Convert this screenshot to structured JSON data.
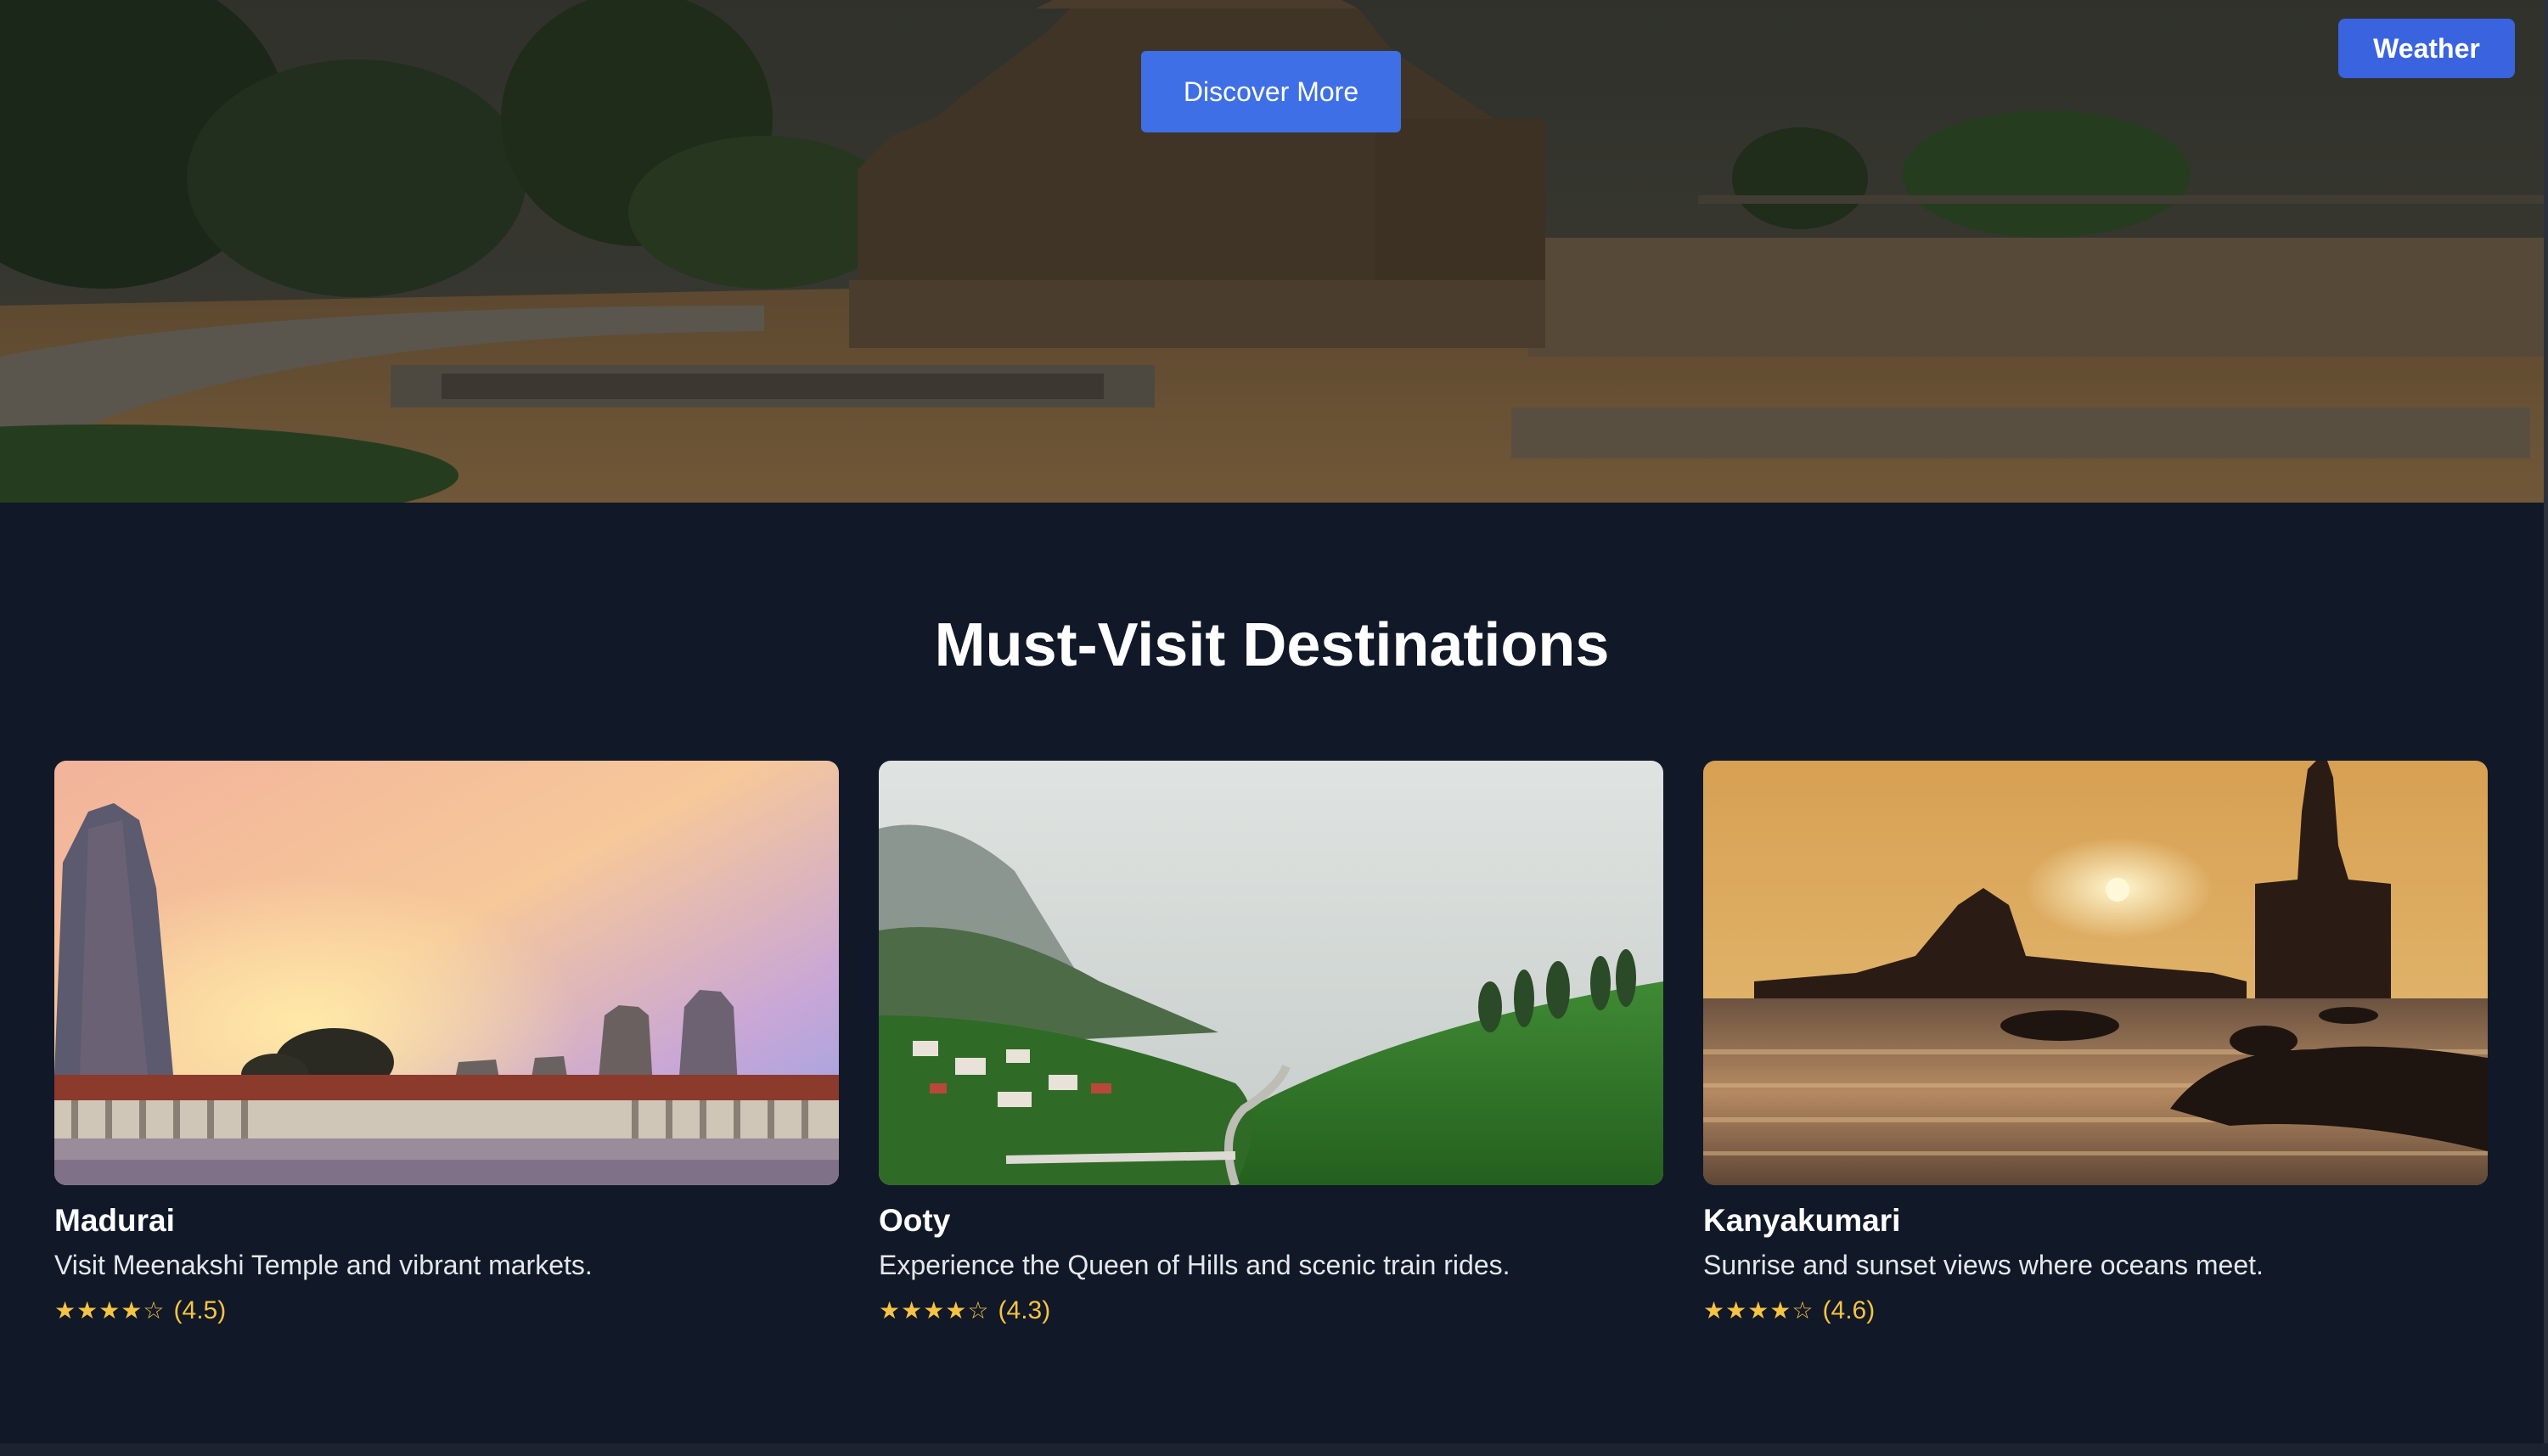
{
  "hero": {
    "discover_label": "Discover More",
    "weather_label": "Weather"
  },
  "section": {
    "title": "Must-Visit Destinations"
  },
  "cards": [
    {
      "title": "Madurai",
      "description": "Visit Meenakshi Temple and vibrant markets.",
      "stars": "★★★★☆",
      "rating": 4.5,
      "rating_text": "(4.5)"
    },
    {
      "title": "Ooty",
      "description": "Experience the Queen of Hills and scenic train rides.",
      "stars": "★★★★☆",
      "rating": 4.3,
      "rating_text": "(4.3)"
    },
    {
      "title": "Kanyakumari",
      "description": "Sunrise and sunset views where oceans meet.",
      "stars": "★★★★☆",
      "rating": 4.6,
      "rating_text": "(4.6)"
    }
  ],
  "colors": {
    "page_background": "#111827",
    "button_blue": "#3f6fe6",
    "star_gold": "#f6c343"
  }
}
